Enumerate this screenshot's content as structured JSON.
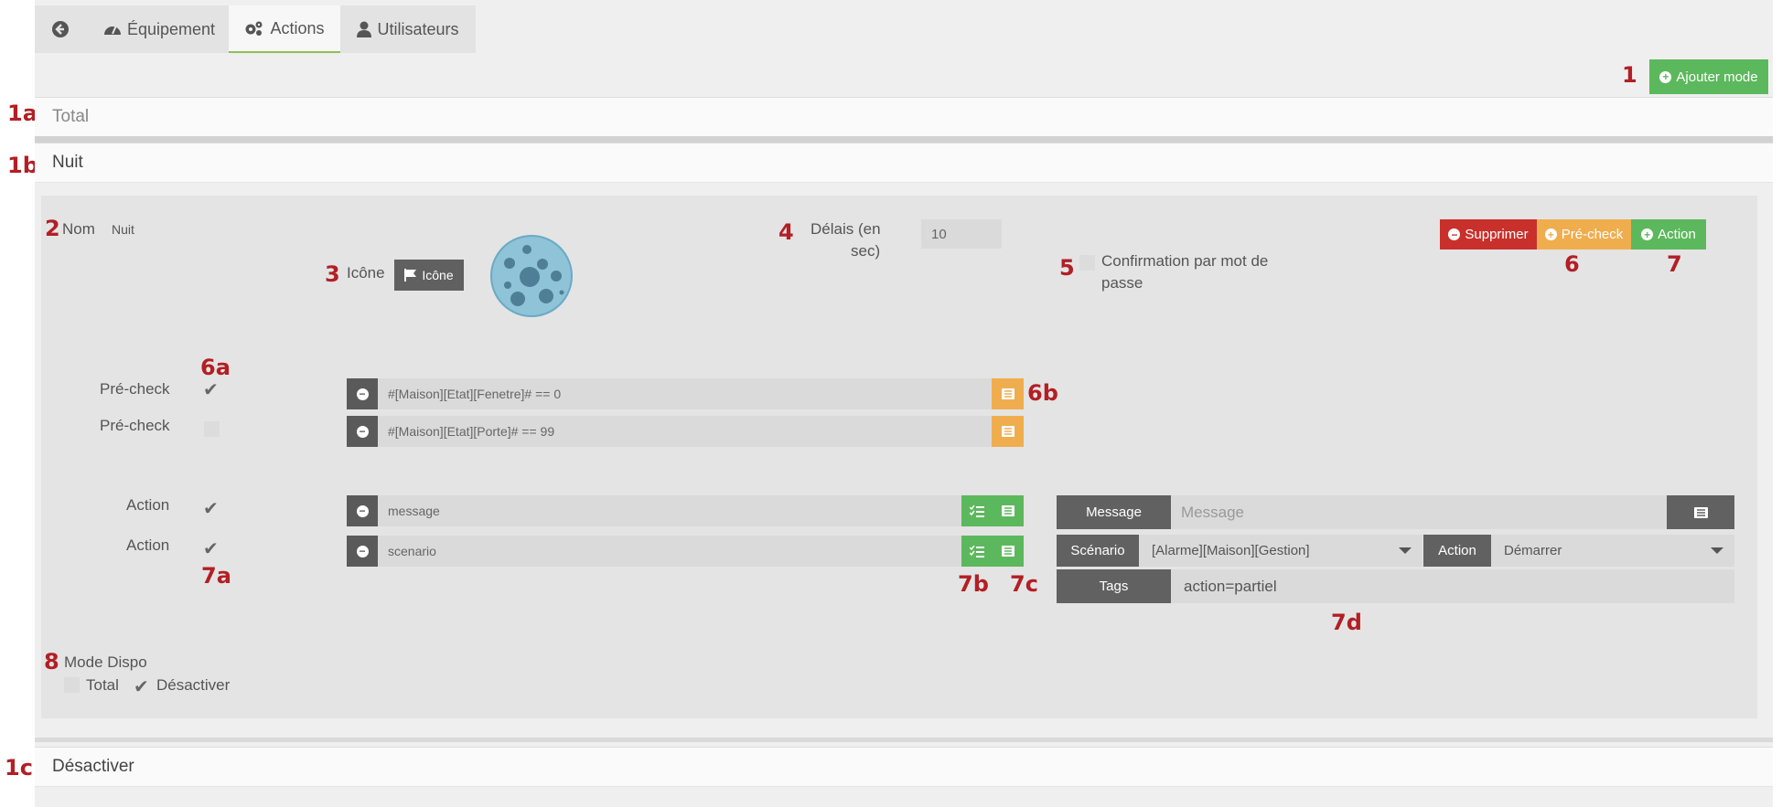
{
  "tabs": {
    "back_icon": "arrow-circle-left-icon",
    "equipement": "Équipement",
    "actions": "Actions",
    "utilisateurs": "Utilisateurs"
  },
  "toolbar": {
    "add_mode": "Ajouter mode"
  },
  "panels": {
    "total": "Total",
    "nuit": "Nuit",
    "desactiver": "Désactiver"
  },
  "markers": {
    "m1": "1",
    "m1a": "1a",
    "m1b": "1b",
    "m1c": "1c",
    "m2": "2",
    "m3": "3",
    "m4": "4",
    "m5": "5",
    "m6": "6",
    "m7": "7",
    "m6a": "6a",
    "m6b": "6b",
    "m7a": "7a",
    "m7b": "7b",
    "m7c": "7c",
    "m7d": "7d",
    "m8": "8"
  },
  "mode": {
    "nom_label": "Nom",
    "nom_value": "Nuit",
    "icone_label": "Icône",
    "icone_button": "Icône",
    "delais_label_1": "Délais (en",
    "delais_label_2": "sec)",
    "delais_value": "10",
    "confirmation_label_1": "Confirmation par mot de",
    "confirmation_label_2": "passe",
    "btn_supprimer": "Supprimer",
    "btn_precheck": "Pré-check",
    "btn_action": "Action"
  },
  "prechecks": [
    {
      "label": "Pré-check",
      "checked": true,
      "value": "#[Maison][Etat][Fenetre]# == 0"
    },
    {
      "label": "Pré-check",
      "checked": false,
      "value": "#[Maison][Etat][Porte]# == 99"
    }
  ],
  "actions": [
    {
      "label": "Action",
      "checked": true,
      "value": "message"
    },
    {
      "label": "Action",
      "checked": true,
      "value": "scenario"
    }
  ],
  "action_options": {
    "message_label": "Message",
    "message_placeholder": "Message",
    "scenario_label": "Scénario",
    "scenario_value": "[Alarme][Maison][Gestion]",
    "action_label": "Action",
    "action_value": "Démarrer",
    "tags_label": "Tags",
    "tags_value": "action=partiel"
  },
  "mode_dispo": {
    "label": "Mode Dispo",
    "total": "Total",
    "desactiver": "Désactiver"
  },
  "colors": {
    "green": "#5cb85c",
    "red": "#c9302c",
    "orange": "#f0ad4e",
    "marker": "#b21f24"
  }
}
